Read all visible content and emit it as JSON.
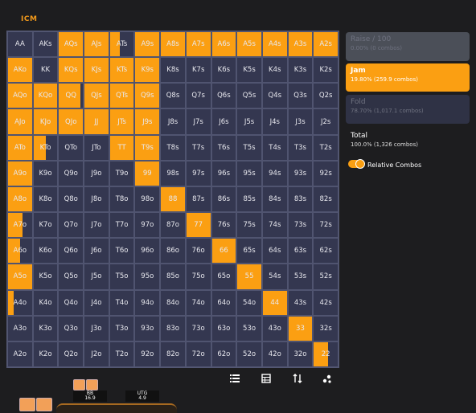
{
  "header": {
    "tab_label": "ICM"
  },
  "ranks": [
    "A",
    "K",
    "Q",
    "J",
    "T",
    "9",
    "8",
    "7",
    "6",
    "5",
    "4",
    "3",
    "2"
  ],
  "grid": {
    "jam_pct": [
      [
        0,
        0,
        1,
        1,
        0.4,
        1,
        1,
        1,
        1,
        1,
        1,
        1,
        1
      ],
      [
        1,
        0,
        1,
        1,
        1,
        1,
        0,
        0,
        0,
        0,
        0,
        0,
        0
      ],
      [
        1,
        1,
        0.9,
        1,
        1,
        1,
        0,
        0,
        0,
        0,
        0,
        0,
        0
      ],
      [
        1,
        1,
        1,
        1,
        1,
        1,
        0,
        0,
        0,
        0,
        0,
        0,
        0
      ],
      [
        1,
        0.5,
        0,
        0,
        1,
        1,
        0,
        0,
        0,
        0,
        0,
        0,
        0
      ],
      [
        1,
        0,
        0,
        0,
        0,
        1,
        0,
        0,
        0,
        0,
        0,
        0,
        0
      ],
      [
        1,
        0,
        0,
        0,
        0,
        0,
        1,
        0,
        0,
        0,
        0,
        0,
        0
      ],
      [
        0.6,
        0,
        0,
        0,
        0,
        0,
        0,
        1,
        0,
        0,
        0,
        0,
        0
      ],
      [
        0.5,
        0,
        0,
        0,
        0,
        0,
        0,
        0,
        1,
        0,
        0,
        0,
        0
      ],
      [
        1,
        0,
        0,
        0,
        0,
        0,
        0,
        0,
        0,
        1,
        0,
        0,
        0
      ],
      [
        0.25,
        0,
        0,
        0,
        0,
        0,
        0,
        0,
        0,
        0,
        1,
        0,
        0
      ],
      [
        0,
        0,
        0,
        0,
        0,
        0,
        0,
        0,
        0,
        0,
        0,
        1,
        0
      ],
      [
        0,
        0,
        0,
        0,
        0,
        0,
        0,
        0,
        0,
        0,
        0,
        0,
        0.6
      ]
    ]
  },
  "actions": {
    "raise": {
      "label": "Raise / 100",
      "detail": "0.00% (0 combos)"
    },
    "jam": {
      "label": "Jam",
      "detail": "19.80% (259.9 combos)"
    },
    "fold": {
      "label": "Fold",
      "detail": "78.70% (1,017.1 combos)"
    }
  },
  "total": {
    "label": "Total",
    "detail": "100.0% (1,326 combos)"
  },
  "toggle": {
    "label": "Relative Combos",
    "on": true
  },
  "toolbar": {
    "icons": [
      "list-icon",
      "table-icon",
      "sort-icon",
      "scatter-icon"
    ]
  },
  "table": {
    "bb": {
      "pos": "BB",
      "stack": "16.9"
    },
    "utg": {
      "pos": "UTG",
      "stack": "4.9"
    }
  },
  "colors": {
    "jam": "#fb9f12",
    "cell": "#343750",
    "fold": "#2f3245"
  }
}
